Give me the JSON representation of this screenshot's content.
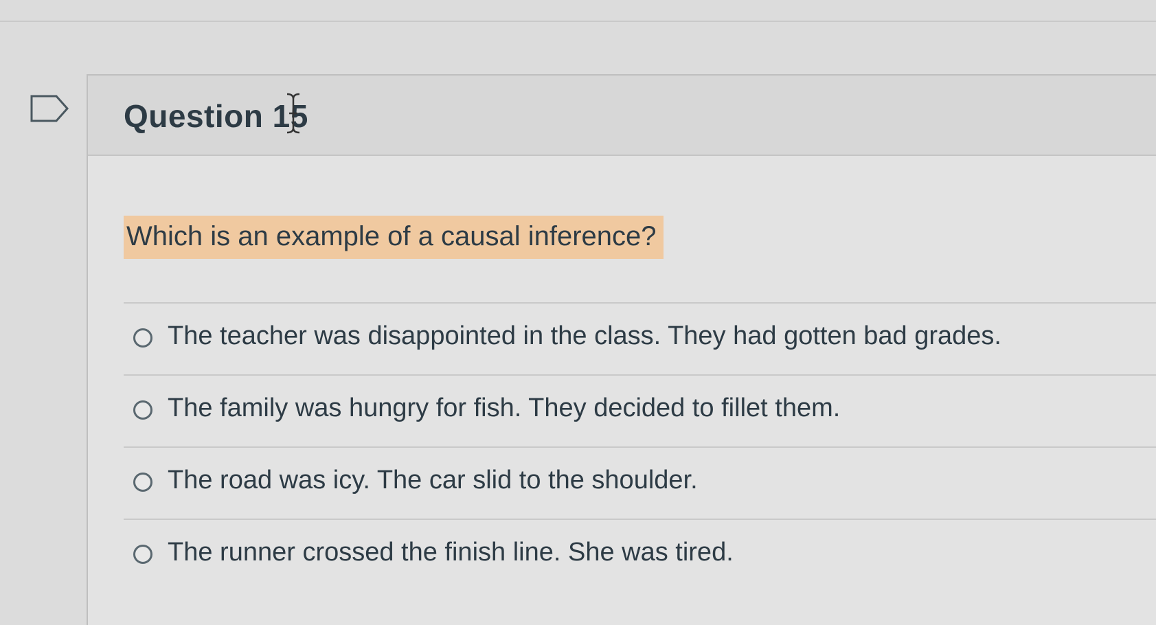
{
  "question": {
    "title": "Question 15",
    "text": "Which is an example of a causal inference?"
  },
  "answers": [
    {
      "label": "The teacher was disappointed in the class. They had gotten bad grades."
    },
    {
      "label": "The family was hungry for fish. They decided to fillet them."
    },
    {
      "label": "The road was icy. The car slid to the shoulder."
    },
    {
      "label": "The runner crossed the finish line. She was tired."
    }
  ],
  "colors": {
    "highlight": "#f0c9a0",
    "text": "#2d3b45",
    "background": "#dcdcdc"
  },
  "icons": {
    "flag": "flag-question-icon",
    "cursor": "text-cursor-icon",
    "radio": "radio-unchecked-icon"
  }
}
